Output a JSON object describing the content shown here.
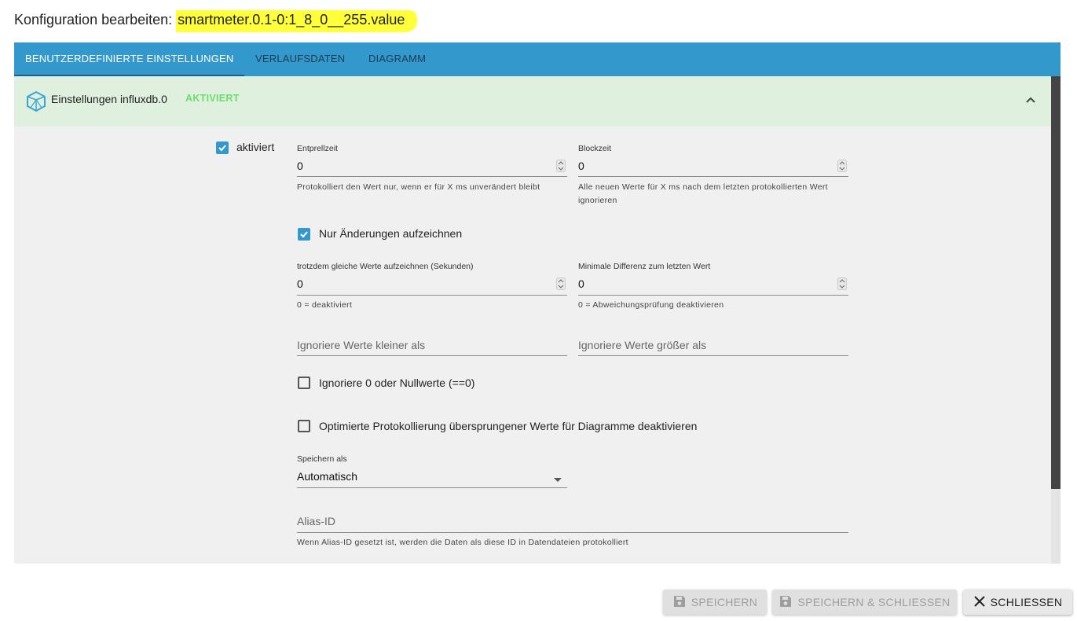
{
  "dialog": {
    "title_prefix": "Konfiguration bearbeiten:",
    "object_id": "smartmeter.0.1-0:1_8_0__255.value"
  },
  "tabs": [
    {
      "label": "BENUTZERDEFINIERTE EINSTELLUNGEN",
      "active": true
    },
    {
      "label": "VERLAUFSDATEN",
      "active": false
    },
    {
      "label": "DIAGRAMM",
      "active": false
    }
  ],
  "accordion": {
    "label": "Einstellungen influxdb.0",
    "status": "AKTIVIERT",
    "icon": "influxdb-logo-icon",
    "expand_icon": "chevron-up-icon"
  },
  "form": {
    "enabled": {
      "label": "aktiviert",
      "checked": true
    },
    "debounce": {
      "label": "Entprellzeit",
      "value": "0",
      "help": "Protokolliert den Wert nur, wenn er für X ms unverändert bleibt"
    },
    "blocktime": {
      "label": "Blockzeit",
      "value": "0",
      "help": "Alle neuen Werte für X ms nach dem letzten protokollierten Wert ignorieren"
    },
    "changes_only": {
      "label": "Nur Änderungen aufzeichnen",
      "checked": true
    },
    "change_interval": {
      "label": "trotzdem gleiche Werte aufzeichnen (Sekunden)",
      "value": "0",
      "help": "0 = deaktiviert"
    },
    "min_difference": {
      "label": "Minimale Differenz zum letzten Wert",
      "value": "0",
      "help": "0 = Abweichungsprüfung deaktivieren"
    },
    "ignore_below": {
      "placeholder": "Ignoriere Werte kleiner als"
    },
    "ignore_above": {
      "placeholder": "Ignoriere Werte größer als"
    },
    "ignore_zero": {
      "label": "Ignoriere 0 oder Nullwerte (==0)",
      "checked": false
    },
    "disable_skipped": {
      "label": "Optimierte Protokollierung übersprungener Werte für Diagramme deaktivieren",
      "checked": false
    },
    "store_as": {
      "label": "Speichern als",
      "value": "Automatisch"
    },
    "alias_id": {
      "placeholder": "Alias-ID",
      "help": "Wenn Alias-ID gesetzt ist, werden die Daten als diese ID in Datendateien protokolliert"
    }
  },
  "buttons": {
    "save": {
      "label": "SPEICHERN",
      "icon": "save-icon",
      "enabled": false
    },
    "save_close": {
      "label": "SPEICHERN & SCHLIESSEN",
      "icon": "save-icon",
      "enabled": false
    },
    "close": {
      "label": "SCHLIESSEN",
      "icon": "close-icon",
      "enabled": true
    }
  },
  "colors": {
    "tab_bar": "#3399cc",
    "accordion_header": "#dff1de",
    "status_green": "#6ddc6d",
    "highlight": "#ffff3a",
    "checkbox": "#3399cc"
  }
}
